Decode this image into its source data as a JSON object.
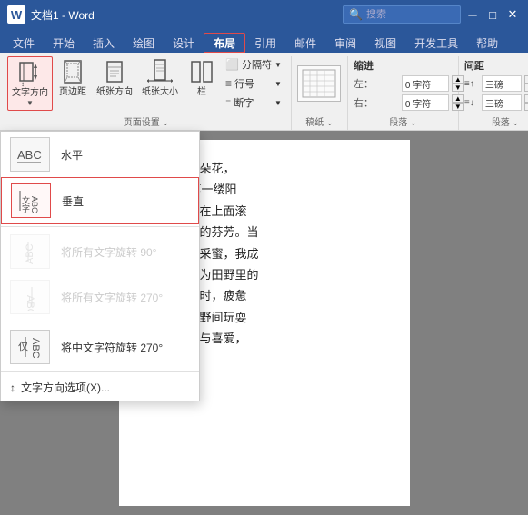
{
  "titleBar": {
    "icon": "W",
    "title": "文档1 - Word",
    "search": {
      "placeholder": "搜索"
    }
  },
  "tabs": [
    {
      "label": "文件",
      "active": false
    },
    {
      "label": "开始",
      "active": false
    },
    {
      "label": "插入",
      "active": false
    },
    {
      "label": "绘图",
      "active": false
    },
    {
      "label": "设计",
      "active": false
    },
    {
      "label": "布局",
      "active": true,
      "highlighted": true
    },
    {
      "label": "引用",
      "active": false
    },
    {
      "label": "邮件",
      "active": false
    },
    {
      "label": "审阅",
      "active": false
    },
    {
      "label": "视图",
      "active": false
    },
    {
      "label": "开发工具",
      "active": false
    },
    {
      "label": "帮助",
      "active": false
    }
  ],
  "ribbon": {
    "groups": [
      {
        "label": "页面设置",
        "buttons": [
          {
            "id": "text-direction",
            "label": "文字方向",
            "active": true
          },
          {
            "id": "margins",
            "label": "页边距"
          },
          {
            "id": "orientation",
            "label": "纸张方向"
          },
          {
            "id": "size",
            "label": "纸张大小"
          },
          {
            "id": "columns",
            "label": "栏"
          }
        ],
        "smallButtons": [
          {
            "label": "分隔符"
          },
          {
            "label": "行号"
          },
          {
            "label": "断字"
          }
        ]
      }
    ],
    "indent": {
      "label": "缩进",
      "left": {
        "label": "左：",
        "value": "0 字符",
        "placeholder": "0 字符"
      },
      "right": {
        "label": "右：",
        "value": "0 字符",
        "placeholder": "0 字符"
      }
    },
    "groupLabel": "稿纸",
    "paragraphLabel": "段落",
    "indent_group_label": "缩进"
  },
  "dropdown": {
    "items": [
      {
        "id": "horizontal",
        "label": "水平",
        "icon": "水平",
        "iconText": "↕ABC",
        "selected": false,
        "disabled": false
      },
      {
        "id": "vertical",
        "label": "垂直",
        "icon": "垂直",
        "iconText": "竖",
        "selected": true,
        "disabled": false
      },
      {
        "id": "rotate90",
        "label": "将所有文字旋转 90°",
        "iconText": "↺90",
        "selected": false,
        "disabled": true
      },
      {
        "id": "rotate270",
        "label": "将所有文字旋转 270°",
        "iconText": "↻270",
        "selected": false,
        "disabled": true
      },
      {
        "id": "cjk270",
        "label": "将中文字符旋转 270°",
        "iconText": "仅CJK",
        "selected": false,
        "disabled": false
      }
    ],
    "footer": {
      "label": "文字方向选项(X)...",
      "icon": "↕"
    }
  },
  "document": {
    "lines": [
      "我想变成一朵花，",
      "清晨，当第一缕阳",
      "瓣，让露珠在上面滚",
      "散发出淡淡的芬芳。当",
      "窟间忙碌地采蜜，我成",
      "　　我想成为田野里的",
      "在田间劳作时，疲惫",
      "孩子们在田野间玩耍",
      "里满是好奇与喜爱，"
    ]
  },
  "icons": {
    "search": "🔍",
    "textDirection": "↕",
    "margins": "▭",
    "orientation": "⬜",
    "size": "📄",
    "columns": "▌▌",
    "separator": "─",
    "lineNum": "#",
    "hyphen": "⁻"
  }
}
